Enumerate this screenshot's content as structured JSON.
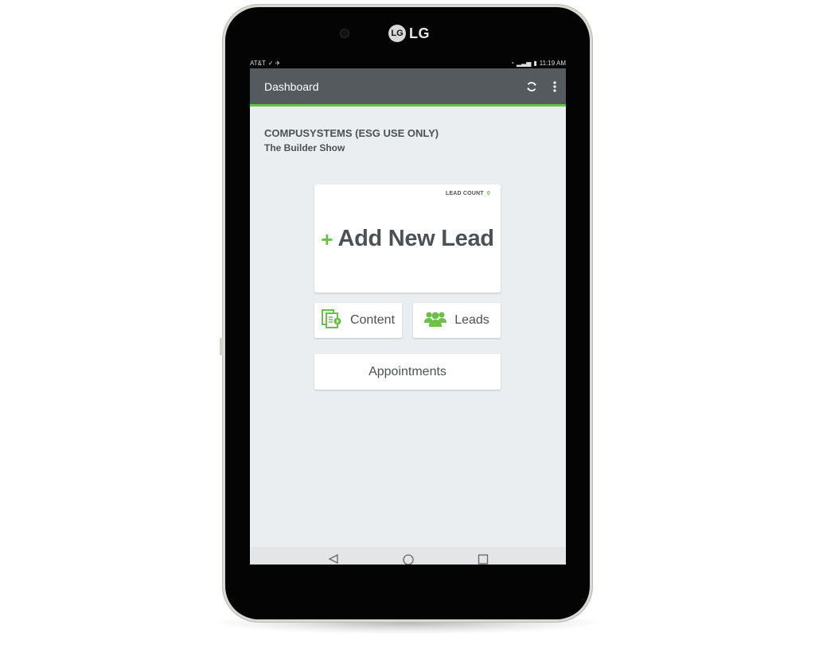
{
  "device": {
    "brand": "LG",
    "brand_mark": "LG"
  },
  "status_bar": {
    "carrier": "AT&T",
    "time": "11:19 AM"
  },
  "app_bar": {
    "title": "Dashboard"
  },
  "org": {
    "name": "COMPUSYSTEMS (ESG USE ONLY)",
    "event": "The Builder Show"
  },
  "add_lead": {
    "count_label": "LEAD COUNT",
    "count_value": "0",
    "plus": "+",
    "label": "Add New Lead"
  },
  "tiles": {
    "content_label": "Content",
    "leads_label": "Leads",
    "appointments_label": "Appointments"
  },
  "icons": {
    "refresh": "refresh-icon",
    "menu": "more-vert-icon",
    "content": "content-icon",
    "leads": "users-icon",
    "back": "back-icon",
    "home": "home-icon",
    "recents": "recents-icon"
  },
  "colors": {
    "accent": "#6cbf4a",
    "app_bar": "#545a5e",
    "screen_bg": "#ebeef0",
    "text": "#4b5154"
  }
}
